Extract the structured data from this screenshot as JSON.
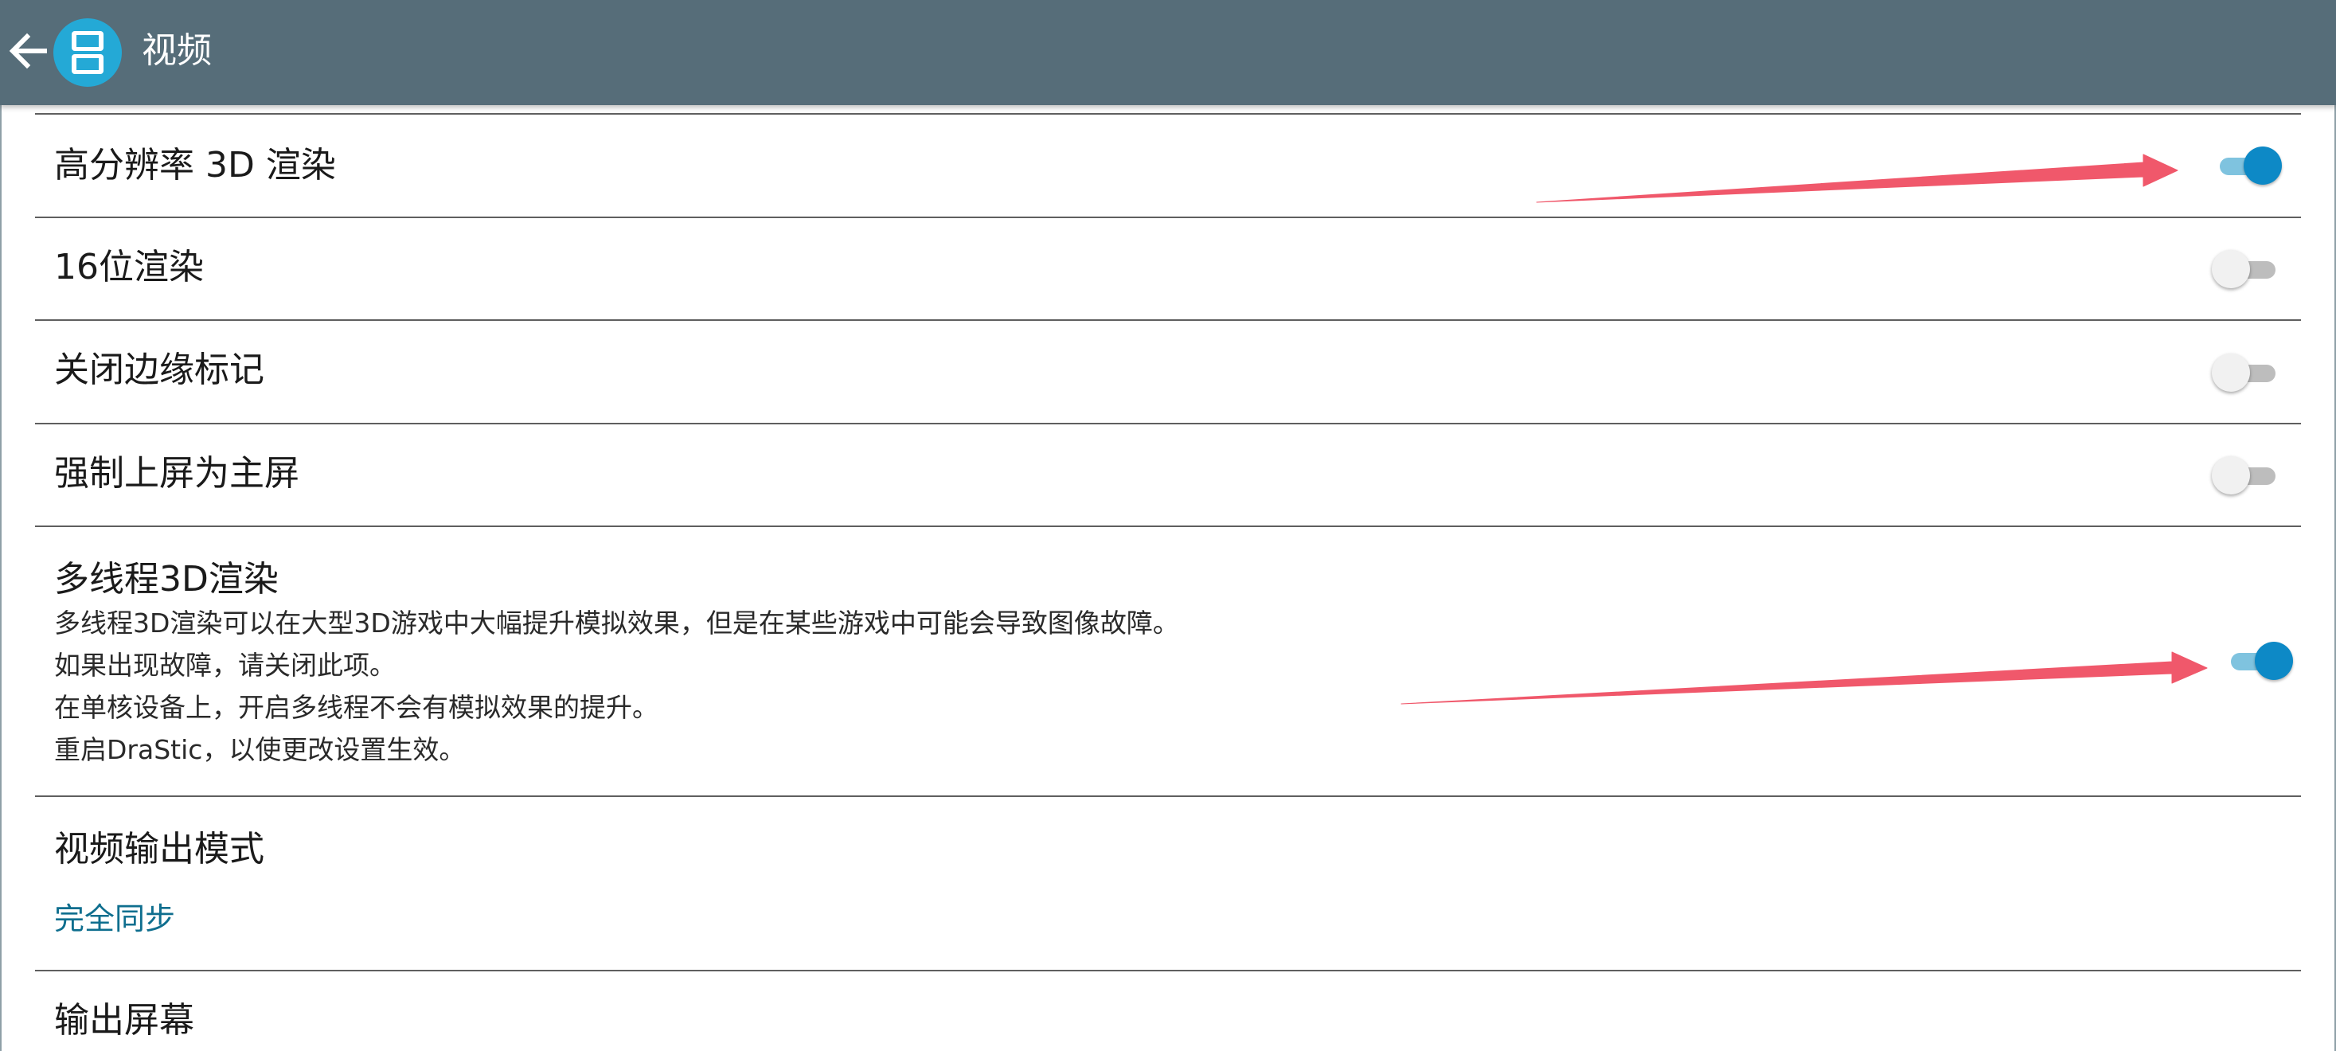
{
  "app_bar": {
    "title": "视频",
    "back_icon": "arrow-back-icon",
    "logo_icon": "nintendo-ds-logo-icon",
    "background": "#566d79"
  },
  "settings": [
    {
      "title": "高分辨率 3D 渲染",
      "enabled": true
    },
    {
      "title": "16位渲染",
      "enabled": false
    },
    {
      "title": "关闭边缘标记",
      "enabled": false
    },
    {
      "title": "强制上屏为主屏",
      "enabled": false
    },
    {
      "title": "多线程3D渲染",
      "enabled": true,
      "summary": [
        "多线程3D渲染可以在大型3D游戏中大幅提升模拟效果，但是在某些游戏中可能会导致图像故障。",
        "如果出现故障，请关闭此项。",
        "在单核设备上，开启多线程不会有模拟效果的提升。",
        "重启DraStic，以使更改设置生效。"
      ]
    },
    {
      "title": "视频输出模式",
      "value": "完全同步"
    },
    {
      "title": "输出屏幕"
    }
  ],
  "colors": {
    "toggle_on_thumb": "#0d89c6",
    "toggle_on_track": "#7fc3df",
    "toggle_off_thumb": "#f1f1f1",
    "toggle_off_track": "#bdbdbd",
    "value_text": "#0e6e8e",
    "annotation_arrow": "#f0586b"
  }
}
